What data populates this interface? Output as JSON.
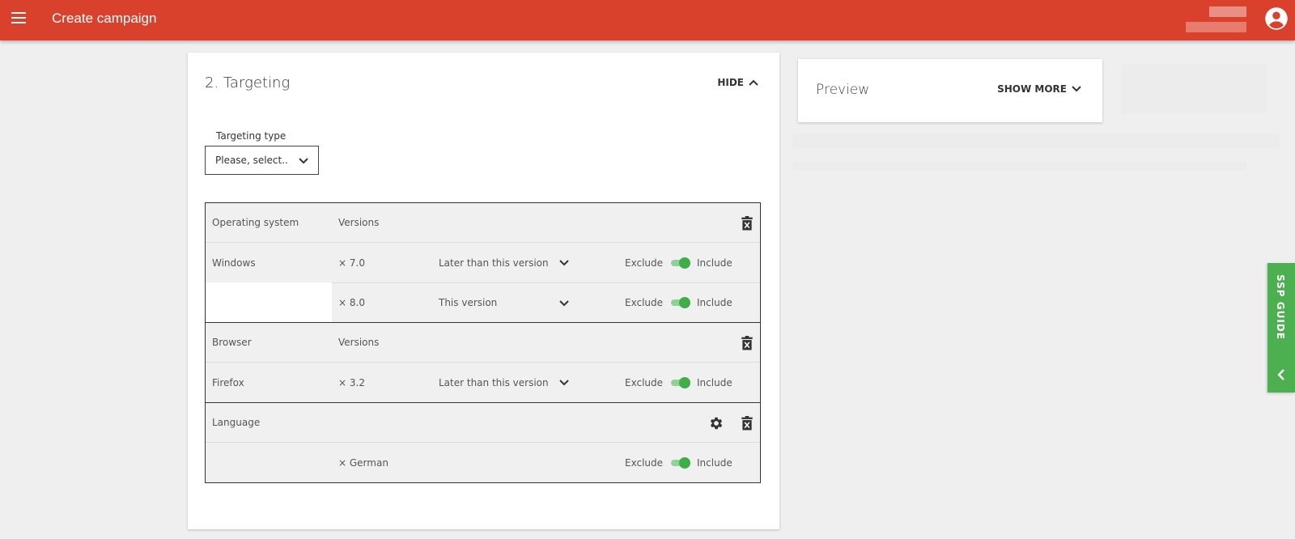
{
  "appbar": {
    "title": "Create campaign"
  },
  "targeting": {
    "section_title": "2. Targeting",
    "hide_label": "HIDE",
    "type_label": "Targeting type",
    "type_select_value": "Please, select..",
    "groups": [
      {
        "name_header": "Operating system",
        "versions_header": "Versions",
        "item_name": "Windows",
        "rows": [
          {
            "version": "× 7.0",
            "condition": "Later than this version",
            "exclude": "Exclude",
            "include": "Include",
            "included": true
          },
          {
            "version": "× 8.0",
            "condition": "This version",
            "exclude": "Exclude",
            "include": "Include",
            "included": true
          }
        ]
      },
      {
        "name_header": "Browser",
        "versions_header": "Versions",
        "item_name": "Firefox",
        "rows": [
          {
            "version": "× 3.2",
            "condition": "Later than this version",
            "exclude": "Exclude",
            "include": "Include",
            "included": true
          }
        ]
      },
      {
        "name_header": "Language",
        "rows": [
          {
            "version": "× German",
            "exclude": "Exclude",
            "include": "Include",
            "included": true
          }
        ]
      }
    ]
  },
  "preview": {
    "title": "Preview",
    "show_more_label": "SHOW MORE"
  },
  "ssp_guide": {
    "label": "SSP GUIDE"
  },
  "colors": {
    "appbar": "#d9412d",
    "toggle_on": "#3fae49",
    "ssp_tab": "#4caf50"
  }
}
